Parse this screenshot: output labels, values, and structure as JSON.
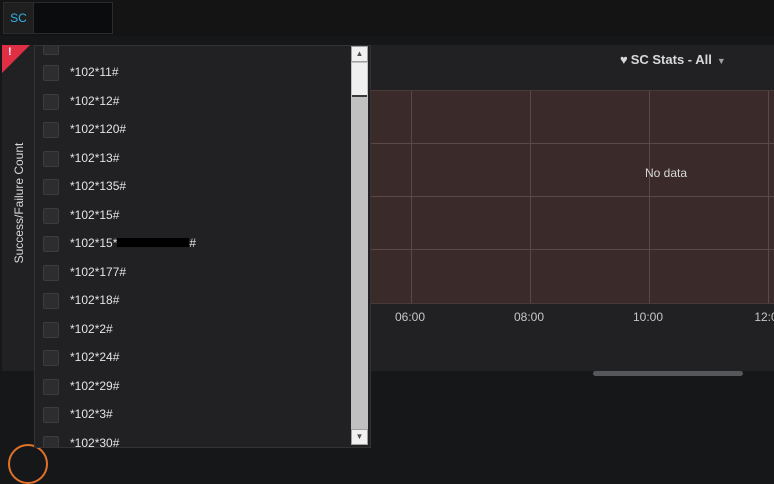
{
  "variable": {
    "label": "SC",
    "value": ""
  },
  "panel": {
    "title": "SC Stats - All",
    "ylabel": "Success/Failure Count",
    "no_data": "No data",
    "xticks": [
      "06:00",
      "08:00",
      "10:00",
      "12:0"
    ]
  },
  "dropdown": {
    "options": [
      {
        "label": "*102*11#",
        "checked": false
      },
      {
        "label": "*102*12#",
        "checked": false
      },
      {
        "label": "*102*120#",
        "checked": false
      },
      {
        "label": "*102*13#",
        "checked": false
      },
      {
        "label": "*102*135#",
        "checked": false
      },
      {
        "label": "*102*15#",
        "checked": false
      },
      {
        "label_prefix": "*102*15*",
        "label_suffix": "#",
        "redacted": true,
        "checked": false
      },
      {
        "label": "*102*177#",
        "checked": false
      },
      {
        "label": "*102*18#",
        "checked": false
      },
      {
        "label": "*102*2#",
        "checked": false
      },
      {
        "label": "*102*24#",
        "checked": false
      },
      {
        "label": "*102*29#",
        "checked": false
      },
      {
        "label": "*102*3#",
        "checked": false
      },
      {
        "label": "*102*30#",
        "checked": false
      }
    ]
  },
  "colors": {
    "alert": "#e02f44",
    "accent": "#33b5e5",
    "plot_bg": "#3a2a2a"
  },
  "icons": {
    "alert": "alert-icon",
    "title": "heart-icon",
    "caret": "caret-down-icon"
  }
}
